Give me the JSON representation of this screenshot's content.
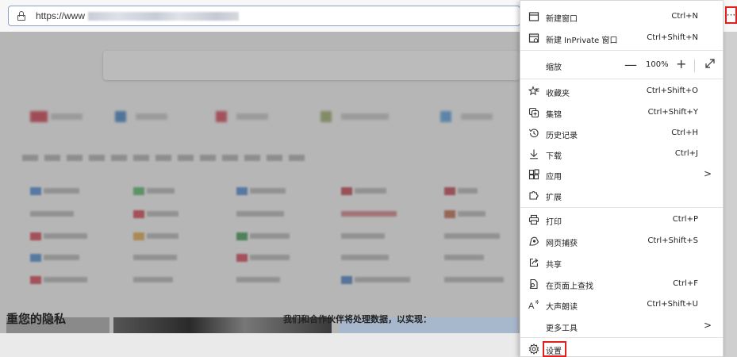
{
  "address_bar": {
    "url": "https://www"
  },
  "more_button": {
    "label": "···"
  },
  "page": {
    "privacy_title": "重您的隐私",
    "privacy_subtitle": "我们和合作伙伴将处理数据，以实现："
  },
  "menu": {
    "new_window": {
      "label": "新建窗口",
      "shortcut": "Ctrl+N"
    },
    "new_inprivate": {
      "label": "新建 InPrivate 窗口",
      "shortcut": "Ctrl+Shift+N"
    },
    "zoom": {
      "label": "缩放",
      "minus": "—",
      "value": "100%",
      "plus": "+"
    },
    "favorites": {
      "label": "收藏夹",
      "shortcut": "Ctrl+Shift+O"
    },
    "collections": {
      "label": "集锦",
      "shortcut": "Ctrl+Shift+Y"
    },
    "history": {
      "label": "历史记录",
      "shortcut": "Ctrl+H"
    },
    "downloads": {
      "label": "下载",
      "shortcut": "Ctrl+J"
    },
    "apps": {
      "label": "应用",
      "arrow": ">"
    },
    "extensions": {
      "label": "扩展"
    },
    "print": {
      "label": "打印",
      "shortcut": "Ctrl+P"
    },
    "web_capture": {
      "label": "网页捕获",
      "shortcut": "Ctrl+Shift+S"
    },
    "share": {
      "label": "共享"
    },
    "find": {
      "label": "在页面上查找",
      "shortcut": "Ctrl+F"
    },
    "read_aloud": {
      "label": "大声朗读",
      "shortcut": "Ctrl+Shift+U"
    },
    "more_tools": {
      "label": "更多工具",
      "arrow": ">"
    },
    "settings": {
      "label": "设置"
    }
  },
  "colors": {
    "highlight_red": "#e02020",
    "menu_bg": "#ffffff"
  }
}
